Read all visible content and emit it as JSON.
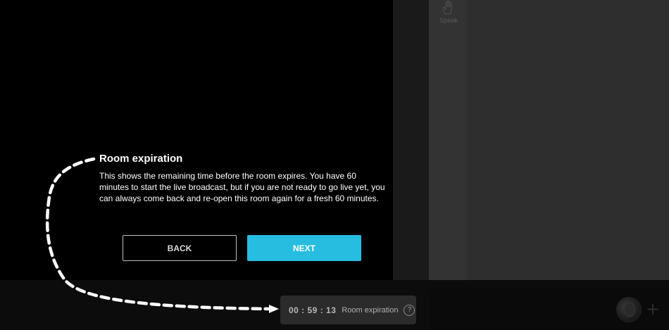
{
  "sidebar": {
    "speak_label": "Speak"
  },
  "tour": {
    "title": "Room expiration",
    "body": "This shows the remaining time before the room expires. You have 60 minutes to start the live broadcast, but if you are not ready to go live yet, you can always come back and re-open this room again for a fresh 60 minutes.",
    "back_label": "BACK",
    "next_label": "NEXT"
  },
  "timer": {
    "value": "00 : 59 : 13",
    "label": "Room expiration",
    "help_glyph": "?"
  },
  "toolbar": {
    "plus_glyph": "+"
  },
  "colors": {
    "accent": "#27bde0",
    "background": "#000000"
  }
}
